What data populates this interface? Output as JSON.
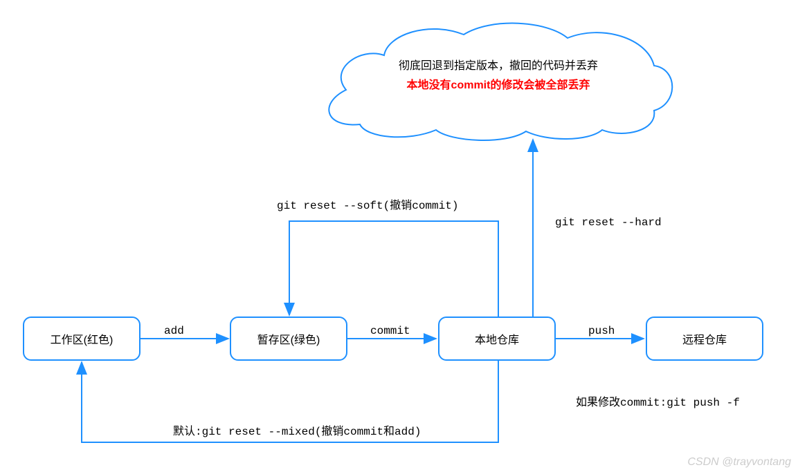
{
  "boxes": {
    "work_area": "工作区(红色)",
    "stage_area": "暂存区(绿色)",
    "local_repo": "本地仓库",
    "remote_repo": "远程仓库"
  },
  "arrows": {
    "add": "add",
    "commit": "commit",
    "push": "push"
  },
  "labels": {
    "reset_soft": "git reset --soft(撤销commit)",
    "reset_hard": "git reset --hard",
    "reset_mixed": "默认:git reset --mixed(撤销commit和add)",
    "push_force": "如果修改commit:git push -f"
  },
  "cloud": {
    "line1": "彻底回退到指定版本，撤回的代码并丢弃",
    "line2": "本地没有commit的修改会被全部丢弃"
  },
  "watermark": "CSDN @trayvontang"
}
